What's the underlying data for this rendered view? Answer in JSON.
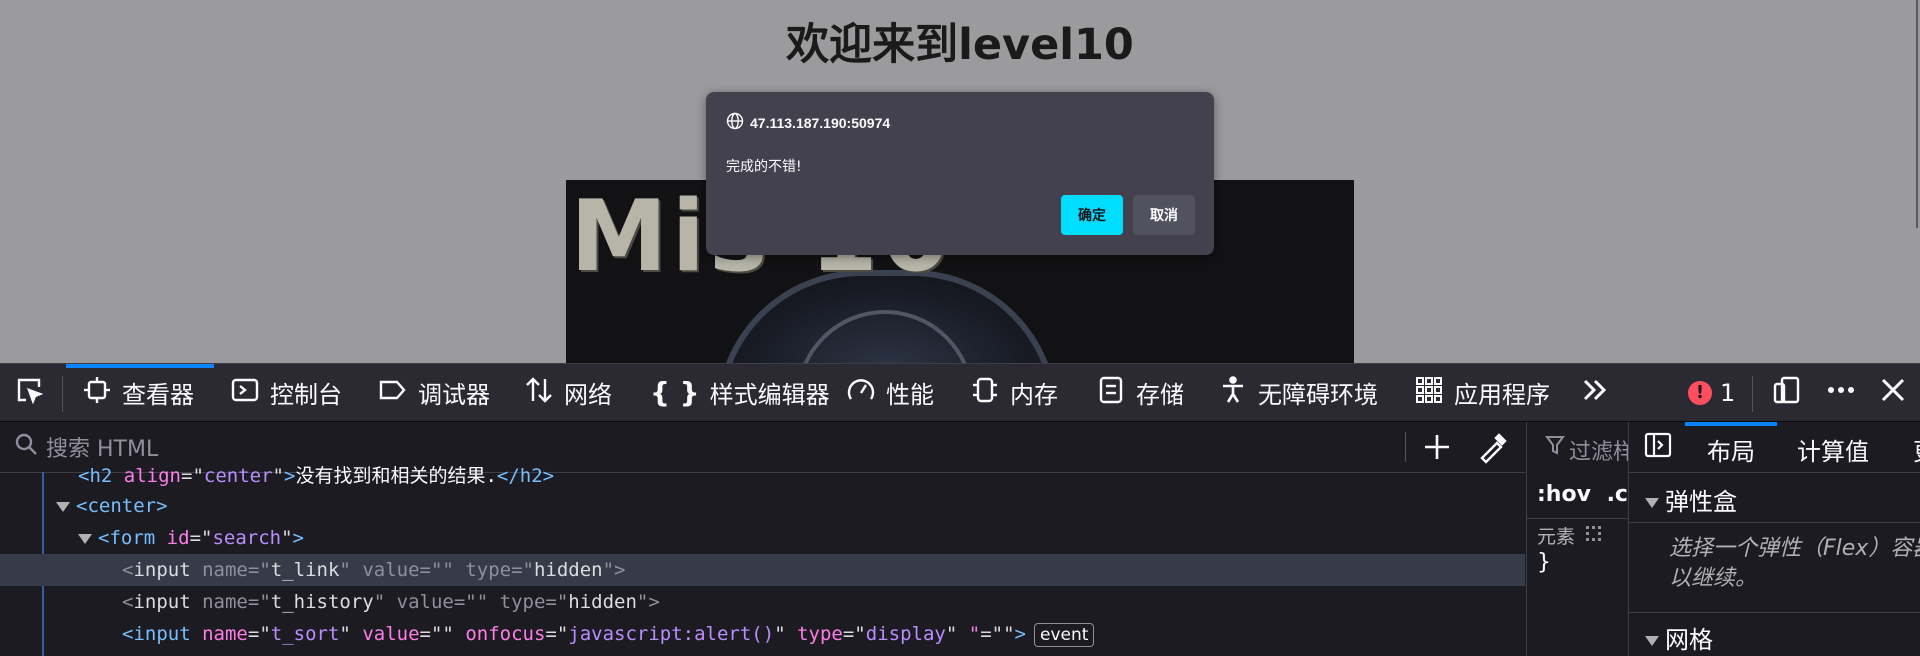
{
  "page": {
    "heading": "欢迎来到level10",
    "banner_text": "Mis          10"
  },
  "dialog": {
    "origin": "47.113.187.190:50974",
    "message": "完成的不错!",
    "ok_label": "确定",
    "cancel_label": "取消"
  },
  "devtools": {
    "tools": [
      {
        "label": "查看器",
        "icon": "inspector-icon"
      },
      {
        "label": "控制台",
        "icon": "console-icon"
      },
      {
        "label": "调试器",
        "icon": "debugger-icon"
      },
      {
        "label": "网络",
        "icon": "network-icon"
      },
      {
        "label": "样式编辑器",
        "icon": "style-editor-icon"
      },
      {
        "label": "性能",
        "icon": "performance-icon"
      },
      {
        "label": "内存",
        "icon": "memory-icon"
      },
      {
        "label": "存储",
        "icon": "storage-icon"
      },
      {
        "label": "无障碍环境",
        "icon": "accessibility-icon"
      },
      {
        "label": "应用程序",
        "icon": "application-icon"
      }
    ],
    "error_count": "1",
    "search_placeholder": "搜索 HTML",
    "tree": {
      "row0": {
        "tag": "h2",
        "attr": "align",
        "value": "center",
        "text": "没有找到和相关的结果."
      },
      "row1": {
        "tag": "center"
      },
      "row2": {
        "tag": "form",
        "attr": "id",
        "value": "search"
      },
      "row3": {
        "tag": "input",
        "a1": "name",
        "v1": "t_link",
        "a2": "value",
        "v2": "",
        "a3": "type",
        "v3": "hidden"
      },
      "row4": {
        "tag": "input",
        "a1": "name",
        "v1": "t_history",
        "a2": "value",
        "v2": "",
        "a3": "type",
        "v3": "hidden"
      },
      "row5": {
        "tag": "input",
        "a1": "name",
        "v1": "t_sort",
        "a2": "value",
        "v2": "",
        "a3": "onfocus",
        "v3": "javascript:alert()",
        "a4": "type",
        "v4": "display",
        "a5": "\"",
        "v5": "",
        "badge": "event"
      }
    },
    "rules": {
      "filter": "过滤样式",
      "pseudo": ":hov .cls",
      "element": "元素",
      "brace": "}"
    },
    "layout": {
      "tabs": [
        "布局",
        "计算值",
        "更改"
      ],
      "flexbox_title": "弹性盒",
      "flexbox_hint_line1": "选择一个弹性（Flex）容器",
      "flexbox_hint_line2": "以继续。",
      "grid_title": "网格"
    }
  },
  "colors": {
    "accent": "#0a84ff",
    "dialog_ok": "#00ddff",
    "tag": "#75bfff",
    "attr_name": "#ff7de9",
    "attr_value": "#b98eff",
    "error": "#ff4f5e"
  }
}
